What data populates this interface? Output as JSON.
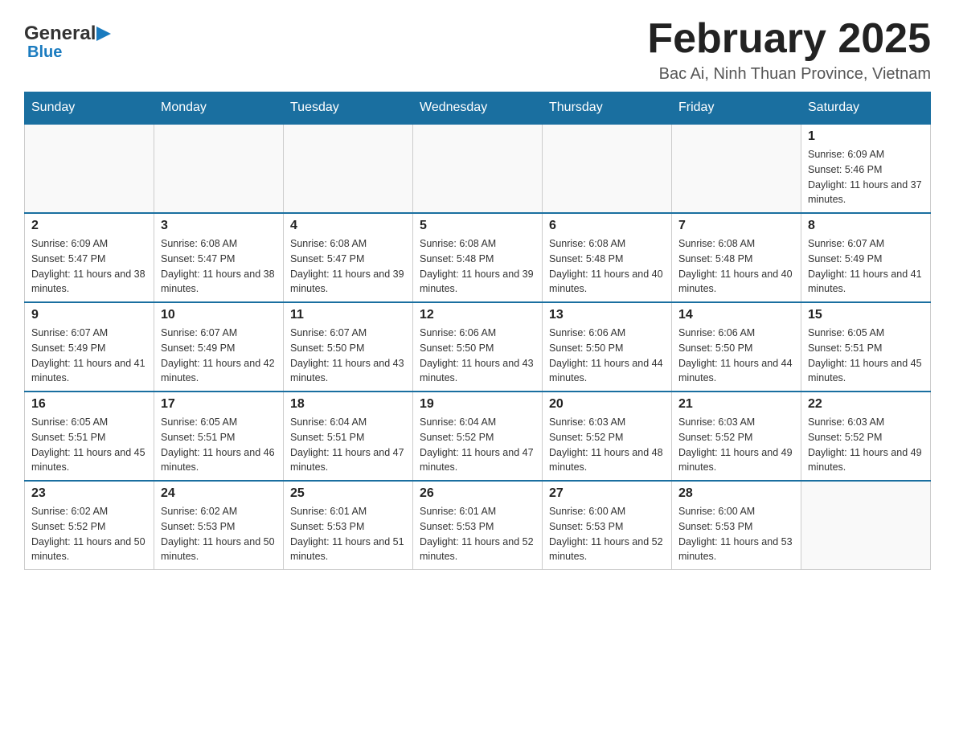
{
  "logo": {
    "general": "General",
    "blue": "Blue",
    "arrow": "▶"
  },
  "header": {
    "title": "February 2025",
    "subtitle": "Bac Ai, Ninh Thuan Province, Vietnam"
  },
  "days_of_week": [
    "Sunday",
    "Monday",
    "Tuesday",
    "Wednesday",
    "Thursday",
    "Friday",
    "Saturday"
  ],
  "weeks": [
    [
      {
        "day": "",
        "info": ""
      },
      {
        "day": "",
        "info": ""
      },
      {
        "day": "",
        "info": ""
      },
      {
        "day": "",
        "info": ""
      },
      {
        "day": "",
        "info": ""
      },
      {
        "day": "",
        "info": ""
      },
      {
        "day": "1",
        "info": "Sunrise: 6:09 AM\nSunset: 5:46 PM\nDaylight: 11 hours and 37 minutes."
      }
    ],
    [
      {
        "day": "2",
        "info": "Sunrise: 6:09 AM\nSunset: 5:47 PM\nDaylight: 11 hours and 38 minutes."
      },
      {
        "day": "3",
        "info": "Sunrise: 6:08 AM\nSunset: 5:47 PM\nDaylight: 11 hours and 38 minutes."
      },
      {
        "day": "4",
        "info": "Sunrise: 6:08 AM\nSunset: 5:47 PM\nDaylight: 11 hours and 39 minutes."
      },
      {
        "day": "5",
        "info": "Sunrise: 6:08 AM\nSunset: 5:48 PM\nDaylight: 11 hours and 39 minutes."
      },
      {
        "day": "6",
        "info": "Sunrise: 6:08 AM\nSunset: 5:48 PM\nDaylight: 11 hours and 40 minutes."
      },
      {
        "day": "7",
        "info": "Sunrise: 6:08 AM\nSunset: 5:48 PM\nDaylight: 11 hours and 40 minutes."
      },
      {
        "day": "8",
        "info": "Sunrise: 6:07 AM\nSunset: 5:49 PM\nDaylight: 11 hours and 41 minutes."
      }
    ],
    [
      {
        "day": "9",
        "info": "Sunrise: 6:07 AM\nSunset: 5:49 PM\nDaylight: 11 hours and 41 minutes."
      },
      {
        "day": "10",
        "info": "Sunrise: 6:07 AM\nSunset: 5:49 PM\nDaylight: 11 hours and 42 minutes."
      },
      {
        "day": "11",
        "info": "Sunrise: 6:07 AM\nSunset: 5:50 PM\nDaylight: 11 hours and 43 minutes."
      },
      {
        "day": "12",
        "info": "Sunrise: 6:06 AM\nSunset: 5:50 PM\nDaylight: 11 hours and 43 minutes."
      },
      {
        "day": "13",
        "info": "Sunrise: 6:06 AM\nSunset: 5:50 PM\nDaylight: 11 hours and 44 minutes."
      },
      {
        "day": "14",
        "info": "Sunrise: 6:06 AM\nSunset: 5:50 PM\nDaylight: 11 hours and 44 minutes."
      },
      {
        "day": "15",
        "info": "Sunrise: 6:05 AM\nSunset: 5:51 PM\nDaylight: 11 hours and 45 minutes."
      }
    ],
    [
      {
        "day": "16",
        "info": "Sunrise: 6:05 AM\nSunset: 5:51 PM\nDaylight: 11 hours and 45 minutes."
      },
      {
        "day": "17",
        "info": "Sunrise: 6:05 AM\nSunset: 5:51 PM\nDaylight: 11 hours and 46 minutes."
      },
      {
        "day": "18",
        "info": "Sunrise: 6:04 AM\nSunset: 5:51 PM\nDaylight: 11 hours and 47 minutes."
      },
      {
        "day": "19",
        "info": "Sunrise: 6:04 AM\nSunset: 5:52 PM\nDaylight: 11 hours and 47 minutes."
      },
      {
        "day": "20",
        "info": "Sunrise: 6:03 AM\nSunset: 5:52 PM\nDaylight: 11 hours and 48 minutes."
      },
      {
        "day": "21",
        "info": "Sunrise: 6:03 AM\nSunset: 5:52 PM\nDaylight: 11 hours and 49 minutes."
      },
      {
        "day": "22",
        "info": "Sunrise: 6:03 AM\nSunset: 5:52 PM\nDaylight: 11 hours and 49 minutes."
      }
    ],
    [
      {
        "day": "23",
        "info": "Sunrise: 6:02 AM\nSunset: 5:52 PM\nDaylight: 11 hours and 50 minutes."
      },
      {
        "day": "24",
        "info": "Sunrise: 6:02 AM\nSunset: 5:53 PM\nDaylight: 11 hours and 50 minutes."
      },
      {
        "day": "25",
        "info": "Sunrise: 6:01 AM\nSunset: 5:53 PM\nDaylight: 11 hours and 51 minutes."
      },
      {
        "day": "26",
        "info": "Sunrise: 6:01 AM\nSunset: 5:53 PM\nDaylight: 11 hours and 52 minutes."
      },
      {
        "day": "27",
        "info": "Sunrise: 6:00 AM\nSunset: 5:53 PM\nDaylight: 11 hours and 52 minutes."
      },
      {
        "day": "28",
        "info": "Sunrise: 6:00 AM\nSunset: 5:53 PM\nDaylight: 11 hours and 53 minutes."
      },
      {
        "day": "",
        "info": ""
      }
    ]
  ]
}
